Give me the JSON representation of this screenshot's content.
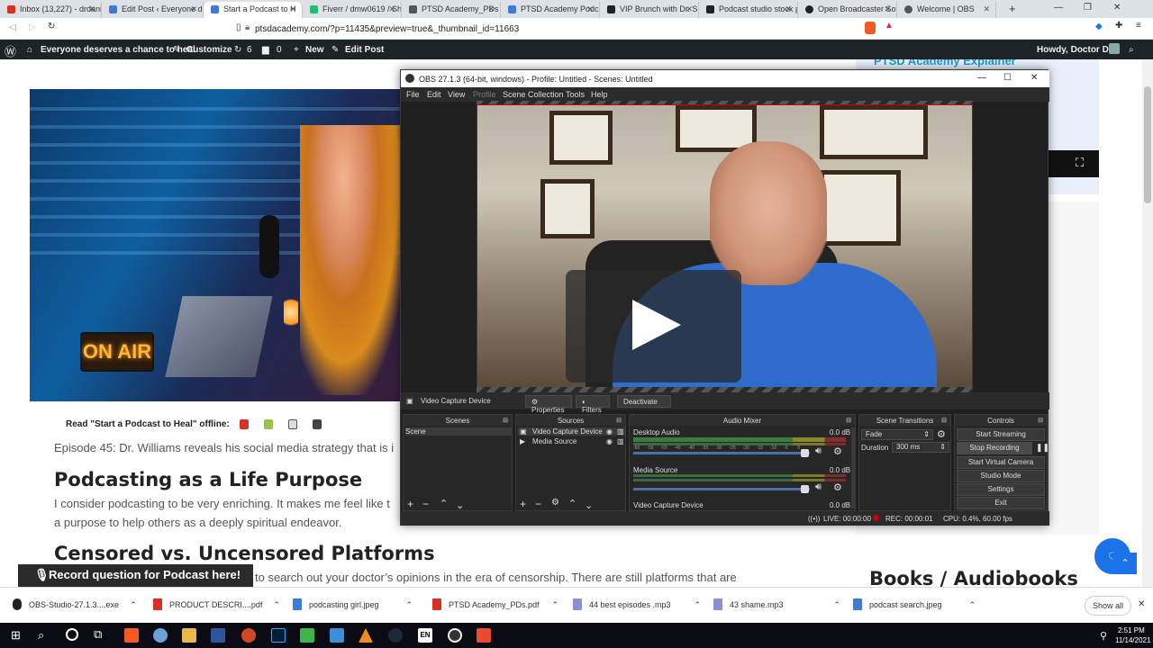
{
  "browser": {
    "tabs": [
      {
        "label": "Inbox (13,227) - drdanie",
        "color": "#d93025"
      },
      {
        "label": "Edit Post ‹ Everyone des",
        "color": "#3c7bd6"
      },
      {
        "label": "Start a Podcast to H",
        "color": "#3c7bd6"
      },
      {
        "label": "Fiverr / dmw0619 / Sho",
        "color": "#1dbf73"
      },
      {
        "label": "PTSD Academy_PDs",
        "color": "#555555"
      },
      {
        "label": "PTSD Academy Podcast",
        "color": "#3c7bd6"
      },
      {
        "label": "VIP Brunch with Dr. She",
        "color": "#222222"
      },
      {
        "label": "Podcast studio stock ph",
        "color": "#222222"
      },
      {
        "label": "Open Broadcaster Softw",
        "color": "#222222"
      },
      {
        "label": "Welcome | OBS",
        "color": "#555555"
      }
    ],
    "new_tab": "+",
    "url": "ptsdacademy.com/?p=11435&preview=true&_thumbnail_id=11663"
  },
  "wp_admin": {
    "site": "Everyone deserves a chance to heal",
    "customize": "Customize",
    "updates": "6",
    "comments": "0",
    "new": "New",
    "edit_post": "Edit Post",
    "howdy": "Howdy, Doctor Dan"
  },
  "page": {
    "hero_sign": "ON AIR",
    "read_offline": "Read \"Start a Podcast to Heal\" offline:",
    "episode_text": "Episode 45: Dr. Williams reveals his social media strategy that is i",
    "h2_1": "Podcasting as a Life Purpose",
    "para1_line1": "I consider podcasting to be very enriching. It makes me feel like t",
    "para1_line2": "a purpose to help others as a deeply spiritual endeavor.",
    "h2_2": "Censored vs. Uncensored Platforms",
    "para2": "to search out your doctor’s opinions in the era of censorship. There are still platforms that are",
    "record_button": "Record question for Podcast here!",
    "sidebar_explainer": "PTSD Academy Explainer",
    "sidebar_books": "Books / Audiobooks"
  },
  "obs": {
    "title": "OBS 27.1.3 (64-bit, windows) - Profile: Untitled - Scenes: Untitled",
    "menu": [
      "File",
      "Edit",
      "View",
      "Profile",
      "Scene Collection",
      "Tools",
      "Help"
    ],
    "source_bar": {
      "source": "Video Capture Device",
      "properties": "Properties",
      "filters": "Filters",
      "deactivate": "Deactivate"
    },
    "docks": {
      "scenes": "Scenes",
      "sources": "Sources",
      "audio_mixer": "Audio Mixer",
      "scene_transitions": "Scene Transitions",
      "controls": "Controls"
    },
    "scenes_list": [
      "Scene"
    ],
    "sources_list": [
      "Video Capture Device",
      "Media Source"
    ],
    "mixer": [
      {
        "name": "Desktop Audio",
        "db": "0.0 dB"
      },
      {
        "name": "Media Source",
        "db": "0.0 dB"
      },
      {
        "name": "Video Capture Device",
        "db": "0.0 dB"
      }
    ],
    "meter_ticks": [
      "-60",
      "-55",
      "-50",
      "-45",
      "-40",
      "-35",
      "-30",
      "-25",
      "-20",
      "-15",
      "-10",
      "-5",
      "0"
    ],
    "transition": "Fade",
    "duration_label": "Duration",
    "duration_value": "300 ms",
    "controls": [
      "Start Streaming",
      "Stop Recording",
      "Start Virtual Camera",
      "Studio Mode",
      "Settings",
      "Exit"
    ],
    "status": {
      "live": "LIVE: 00:00:00",
      "rec": "REC: 00:00:01",
      "cpu": "CPU: 0.4%, 60.00 fps"
    }
  },
  "downloads": {
    "items": [
      {
        "name": "OBS-Studio-27.1.3....exe",
        "color": "#222222"
      },
      {
        "name": "PRODUCT DESCRI....pdf",
        "color": "#d93025"
      },
      {
        "name": "podcasting girl.jpeg",
        "color": "#3c7bd6"
      },
      {
        "name": "PTSD Academy_PDs.pdf",
        "color": "#d93025"
      },
      {
        "name": "44 best episodes .mp3",
        "color": "#8a8fd6"
      },
      {
        "name": "43 shame.mp3",
        "color": "#8a8fd6"
      },
      {
        "name": "podcast search.jpeg",
        "color": "#3c7bd6"
      }
    ],
    "show_all": "Show all"
  },
  "taskbar": {
    "time": "2:51 PM",
    "date": "11/14/2021"
  }
}
